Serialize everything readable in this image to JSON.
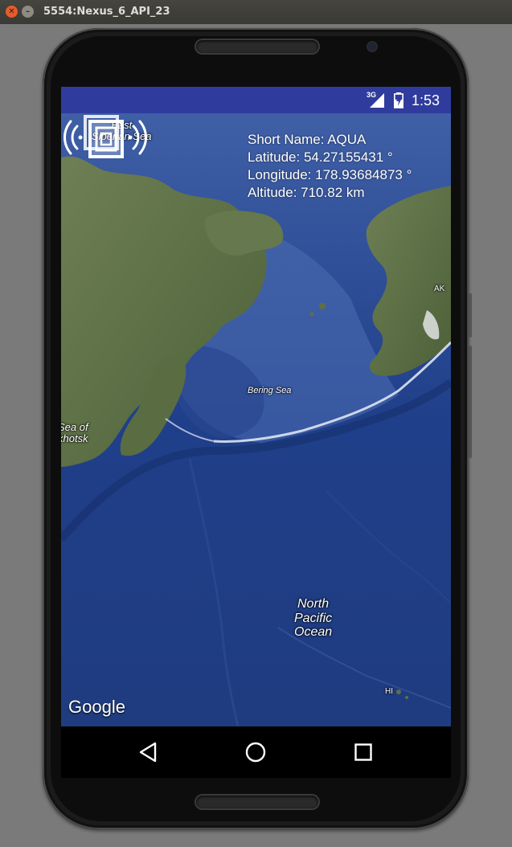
{
  "window": {
    "title": "5554:Nexus_6_API_23"
  },
  "status_bar": {
    "network": "3G",
    "time": "1:53",
    "color": "#2f3c9d"
  },
  "satellite": {
    "short_name": "Short Name: AQUA",
    "latitude": "Latitude: 54.27155431 °",
    "longitude": "Longitude: 178.93684873 °",
    "altitude": "Altitude: 710.82 km",
    "marker_icon": "satellite-icon"
  },
  "map": {
    "labels": {
      "east_siberian_sea": "East\nSiberian Sea",
      "sea_of_okhotsk": "Sea of\nkhotsk",
      "bering_sea": "Bering Sea",
      "north_pacific_ocean": "North\nPacific\nOcean",
      "ak": "AK",
      "hi": "HI"
    },
    "attribution": "Google"
  },
  "nav_bar": {
    "back_icon": "back-icon",
    "home_icon": "home-icon",
    "recents_icon": "recents-icon"
  }
}
